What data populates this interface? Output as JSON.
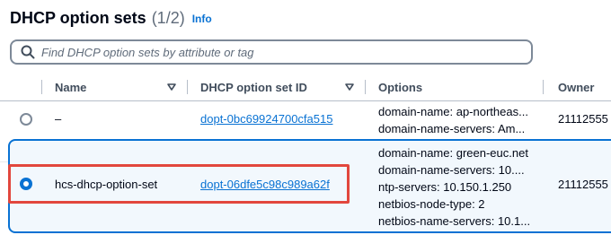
{
  "header": {
    "title": "DHCP option sets",
    "count": "(1/2)",
    "info": "Info"
  },
  "search": {
    "placeholder": "Find DHCP option sets by attribute or tag"
  },
  "table": {
    "columns": [
      "Name",
      "DHCP option set ID",
      "Options",
      "Owner"
    ],
    "rows": [
      {
        "name": "–",
        "id": "dopt-0bc69924700cfa515",
        "options": [
          "domain-name: ap-northeas...",
          "domain-name-servers: Am..."
        ],
        "owner": "21112555",
        "selected": false
      },
      {
        "name": "hcs-dhcp-option-set",
        "id": "dopt-06dfe5c98c989a62f",
        "options": [
          "domain-name: green-euc.net",
          "domain-name-servers: 10....",
          "ntp-servers: 10.150.1.250",
          "netbios-node-type: 2",
          "netbios-name-servers: 10.1..."
        ],
        "owner": "21112555",
        "selected": true
      }
    ]
  },
  "colors": {
    "accent": "#0972d3",
    "selected_row_bg": "#f2f8fd",
    "highlight": "#e2473d"
  },
  "icons": {
    "search": "search-icon",
    "sort": "caret-down-icon"
  }
}
